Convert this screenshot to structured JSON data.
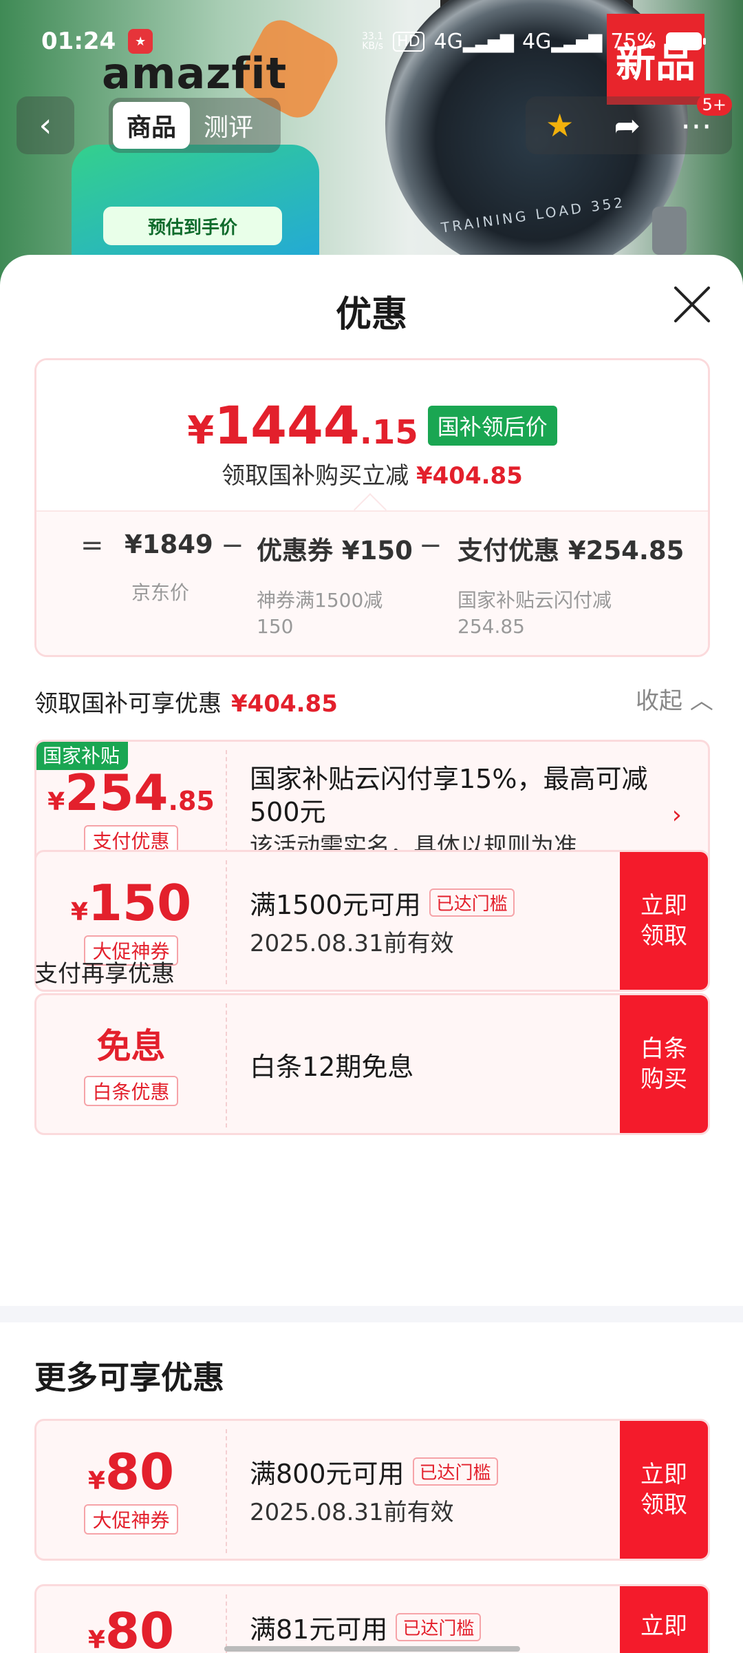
{
  "status_bar": {
    "time": "01:24",
    "network_speed": "33.1\nKB/s",
    "hd_label": "HD",
    "sig1": "4G",
    "sig2": "4G",
    "battery_pct": "75%"
  },
  "hero": {
    "brand": "amazfit",
    "box_tag": "预估到手价",
    "new_badge": "新品",
    "watch_text": "TRAINING LOAD 352"
  },
  "nav": {
    "tabs": [
      {
        "label": "商品"
      },
      {
        "label": "测评"
      }
    ],
    "more_badge": "5+"
  },
  "sheet": {
    "title": "优惠",
    "summary": {
      "price_currency": "¥",
      "price_int": "1444",
      "price_dec": ".15",
      "price_tag": "国补领后价",
      "sub_text": "领取国补购买立减",
      "sub_amount": "¥404.85",
      "calc": [
        {
          "op": "=",
          "value": "¥1849",
          "desc": "京东价"
        },
        {
          "op": "−",
          "value": "优惠券 ¥150",
          "desc": "神券满1500减150"
        },
        {
          "op": "−",
          "value": "支付优惠 ¥254.85",
          "desc": "国家补贴云闪付减254.85"
        }
      ]
    },
    "section1": {
      "label": "领取国补可享优惠",
      "amount": "¥404.85",
      "collapse": "收起"
    },
    "subsidy_card": {
      "ribbon": "国家补贴",
      "currency": "¥",
      "int": "254",
      "dec": ".85",
      "type": "支付优惠",
      "text": "国家补贴云闪付享15%，最高可减500元",
      "sub": "该活动需实名，具体以规则为准"
    },
    "coupon1": {
      "currency": "¥",
      "int": "150",
      "type": "大促神券",
      "line1": "满1500元可用",
      "threshold": "已达门槛",
      "line2": "2025.08.31前有效",
      "button": "立即领取"
    },
    "section2": {
      "label": "支付再享优惠"
    },
    "coupon2": {
      "word": "免息",
      "type": "白条优惠",
      "line1": "白条12期免息",
      "button": "白条购买"
    },
    "more_title": "更多可享优惠",
    "coupon3": {
      "currency": "¥",
      "int": "80",
      "type": "大促神券",
      "line1": "满800元可用",
      "threshold": "已达门槛",
      "line2": "2025.08.31前有效",
      "button": "立即领取"
    },
    "coupon4": {
      "currency": "¥",
      "int": "80",
      "line1": "满81元可用",
      "threshold": "已达门槛",
      "button": "立即"
    }
  },
  "colors": {
    "accent_red": "#e3202c",
    "button_red": "#f41b2b",
    "subsidy_green": "#1aa652"
  }
}
